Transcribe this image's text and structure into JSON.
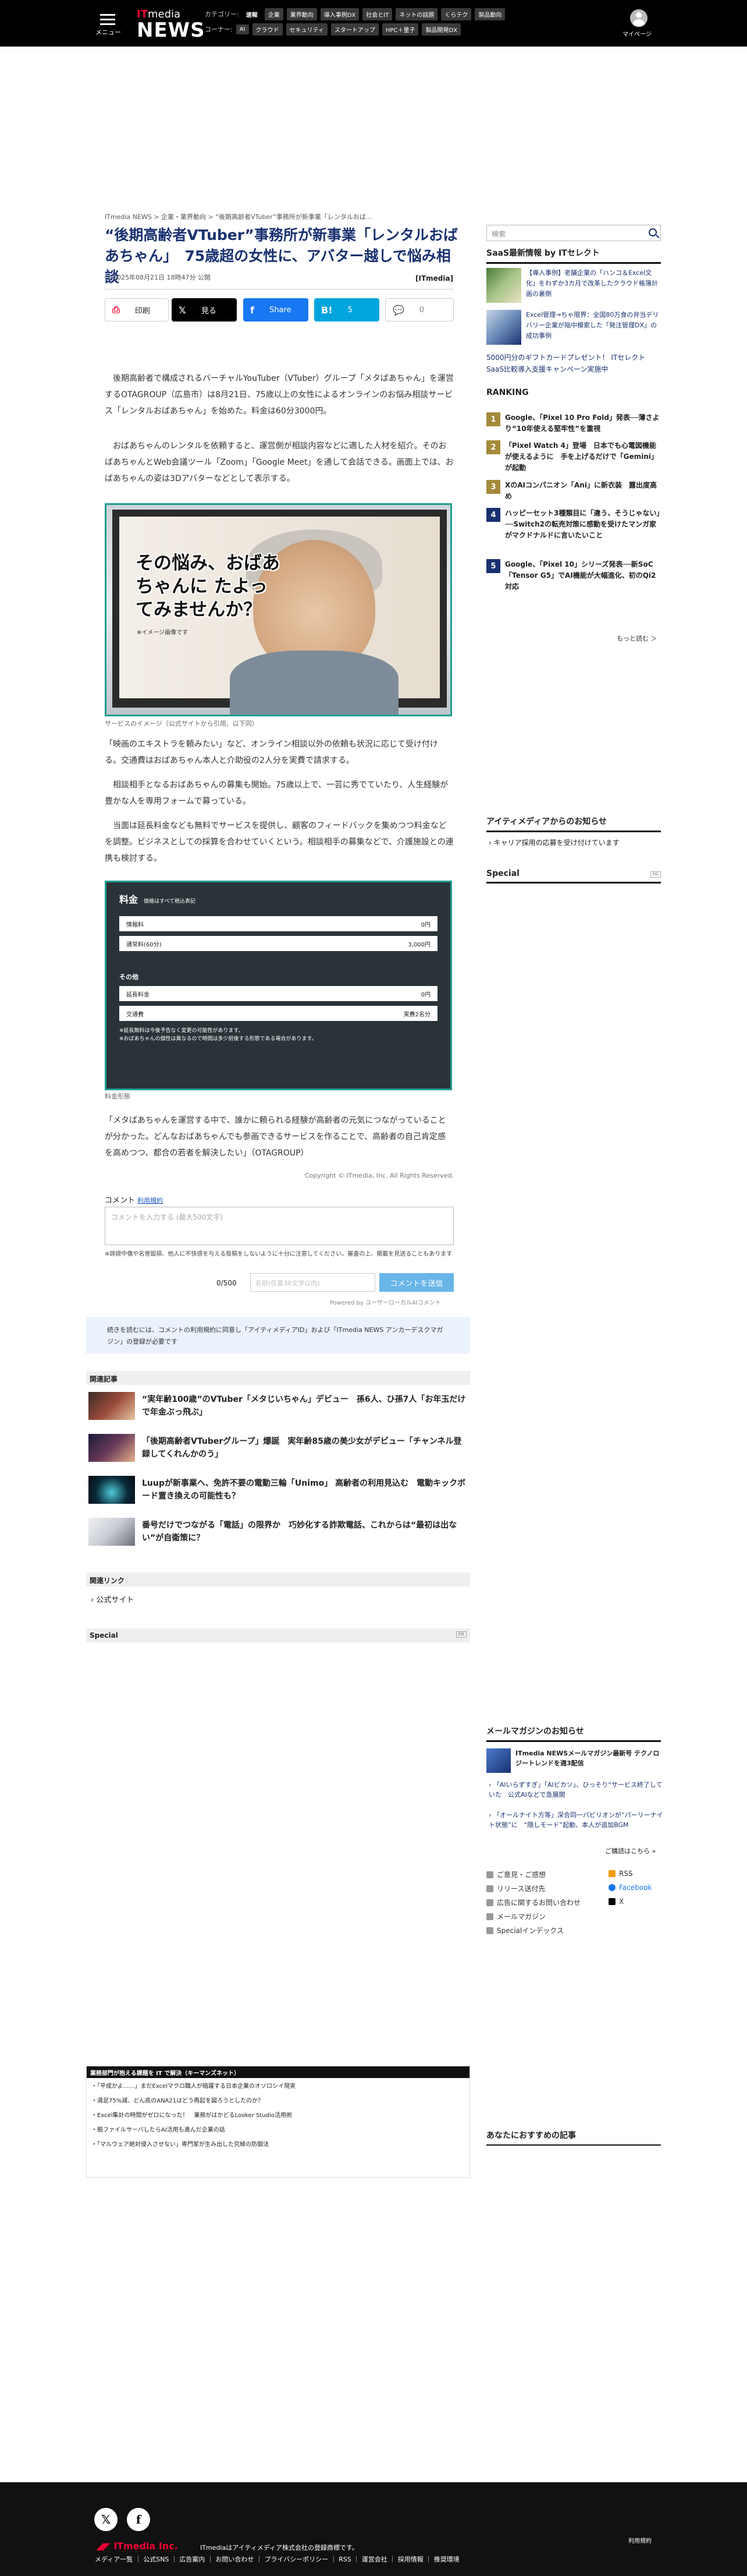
{
  "header": {
    "menu_label": "メニュー",
    "logo_top": "IT",
    "logo_media": "media",
    "logo_news": "NEWS",
    "category_label": "カテゴリー:",
    "categories": [
      "速報",
      "速報",
      "業界動向",
      "導入事例DX",
      "社会とIT",
      "ネットの話題",
      "くらテク",
      "製品",
      "速報"
    ],
    "category_chips": [
      "速報",
      "企業",
      "業界動向",
      "導入事例DX",
      "社会とIT",
      "ネットの話題",
      "くらテク",
      "製品動向"
    ],
    "corner_label": "コーナー:",
    "corner_chips": [
      "AI",
      "クラウド",
      "セキュリティ",
      "スタートアップ",
      "HPC＋量子",
      "製品開発DX"
    ],
    "mypage": "マイページ"
  },
  "article": {
    "breadcrumb": "ITmedia NEWS > 企業・業界動向 > “後期高齢者VTuber”事務所が新事業「レンタルおば…",
    "title": "“後期高齢者VTuber”事務所が新事業「レンタルおばあちゃん」　75歳超の女性に、アバター越しで悩み相談",
    "date": "2025年08月21日 18時47分 公開",
    "publisher": "[ITmedia]",
    "share": {
      "print": "印刷",
      "x": "見る",
      "facebook": "Share",
      "hatena": "5",
      "comments": "0"
    },
    "p1": "　後期高齢者で構成されるバーチャルYouTuber（VTuber）グループ「メタばあちゃん」を運営するOTAGROUP（広島市）は8月21日、75歳以上の女性によるオンラインのお悩み相談サービス「レンタルおばあちゃん」を始めた。料金は60分3000円。",
    "p2": "　おばあちゃんのレンタルを依頼すると、運営側が相談内容などに適した人材を紹介。そのおばあちゃんとWeb会議ツール「Zoom」「Google Meet」を通して会話できる。画面上では、おばあちゃんの姿は3Dアバターなどとして表示する。",
    "hero_headline": "その悩み、おばあちゃんに たよってみませんか？",
    "hero_sub": "※イメージ画像です",
    "hero_caption": "サービスのイメージ（公式サイトから引用、以下同）",
    "p3": "「映画のエキストラを頼みたい」など、オンライン相談以外の依頼も状況に応じて受け付ける。交通費はおばあちゃん本人と介助役の2人分を実費で請求する。",
    "p4": "　相談相手となるおばあちゃんの募集も開始。75歳以上で、一芸に秀でていたり、人生経験が豊かな人を専用フォームで募っている。",
    "p5": "　当面は延長料金なども無料でサービスを提供し、顧客のフィードバックを集めつつ料金などを調整。ビジネスとしての採算を合わせていくという。相談相手の募集などで、介護施設との連携も検討する。",
    "price_title": "料金",
    "price_tax": "価格はすべて税込表記",
    "price_rows": [
      {
        "name": "情報料",
        "value": "0円"
      },
      {
        "name": "通常料(60分)",
        "value": "3,000円"
      }
    ],
    "price_other": "その他",
    "price_rows2": [
      {
        "name": "延長料金",
        "value": "0円"
      },
      {
        "name": "交通費",
        "value": "実費2名分"
      }
    ],
    "price_note": "※延長無料は今後予告なく変更の可能性があります。\n※おばあちゃんの個性は異なるので時間は多少前後する形態である場合があります。",
    "price_caption": "料金形態",
    "p6": "「メタばあちゃんを運営する中で、誰かに頼られる経験が高齢者の元気につながっていることが分かった。どんなおばあちゃんでも参画できるサービスを作ることで、高齢者の自己肯定感を高めつつ、都合の若者を解決したい」（OTAGROUP）",
    "copyright": "Copyright © ITmedia, Inc. All Rights Reserved."
  },
  "comment": {
    "label": "コメント",
    "terms": "利用規約",
    "placeholder": "コメントを入力する (最大500文字)",
    "rule": "※誹謗中傷や名誉毀損、他人に不快感を与える投稿をしないように十分に注意してください。審査の上、掲載を見送ることもあります",
    "count": "0/500",
    "nick_placeholder": "名前(任意30文字以内)",
    "submit": "コメントを送信",
    "powered": "Powered by ユーザーローカルAIコメント",
    "notice": "続きを読むには、コメントの利用規約に同意し「アイティメディアID」および「ITmedia NEWS アンカーデスクマガジン」の登録が必要です"
  },
  "related": {
    "heading": "関連記事",
    "items": [
      "“実年齢100歳”のVTuber「メタじいちゃん」デビュー　孫6人、ひ孫7人「お年玉だけで年金ぶっ飛ぶ」",
      "「後期高齢者VTuberグループ」爆誕　実年齢85歳の美少女がデビュー「チャンネル登録してくれんかのう」",
      "Luupが新事業へ、免許不要の電動三輪「Unimo」 高齢者の利用見込む　電動キックボード置き換えの可能性も？",
      "番号だけでつながる「電話」の限界か　巧妙化する詐欺電話、これからは“最初は出ない”が自衛策に？"
    ],
    "links_heading": "関連リンク",
    "link": "公式サイト",
    "special": "Special",
    "pr": "PR"
  },
  "sidebar": {
    "search_placeholder": "検索",
    "saas_heading": "SaaS最新情報 by ITセレクト",
    "saas_items": [
      "【導入事例】老舗企業の「ハンコ＆Excel文化」をわずか3カ月で改革したクラウド帳簿計画の裏側",
      "Excel管理→ちゃ限界：全国80万食の弁当デリバリー企業が陥中模索した「発注管理DX」の成功事例"
    ],
    "promo": "5000円分のギフトカードプレゼント！ ITセレクトSaaS比較導入支援キャンペーン実施中",
    "ranking_heading": "RANKING",
    "ranking": [
      "Google、「Pixel 10 Pro Fold」発表──薄さより“10年使える堅牢性”を重視",
      "「Pixel Watch 4」登場　日本でも心電図機能が使えるように　手を上げるだけで「Gemini」が起動",
      "XのAIコンパニオン「Ani」に新衣装　露出度高め",
      "ハッピーセット3種類目に「違う、そうじゃない」──Switch2の転売対策に感動を受けたマンガ家がマクドナルドに言いたいこと",
      "Google、「Pixel 10」シリーズ発表──新SoC「Tensor G5」でAI機能が大幅進化、初のQi2対応"
    ],
    "more": "もっと読む ＞",
    "notice_heading": "アイティメディアからのお知らせ",
    "notice_item": "キャリア採用の応募を受け付けています",
    "special": "Special",
    "pr": "PR",
    "mm_heading": "メールマガジンのお知らせ",
    "mm_title": "ITmedia NEWSメールマガジン最新号 テクノロジートレンドを週3配信",
    "mm_items": [
      "「AIいらずすぎ」「AIビカソ」、ひっそり“サービス終了していた　公式AIなどで急展開",
      "「オールナイト方等」深合同一パビリオンが“パーリーナイト状態”に　“隠しモード”起動、本人が追加BGM"
    ],
    "back_numbers": "ご購読はこちら »",
    "foot_links": [
      "ご意見・ご感想",
      "RSS",
      "リリース送付先",
      "Facebook",
      "広告に関するお問い合わせ",
      "X",
      "メールマガジン",
      "Specialインデックス"
    ],
    "recommended": "あなたにおすすめの記事"
  },
  "business": {
    "heading": "業務部門が抱える課題を IT で解決（キーマンズネット）",
    "items": [
      "「平成かよ……」まだExcelマクロ職人が暗躍する日本企業のオソロシイ現実",
      "満足75%減、どん底のANA21はどう再起を図ろうとしたのか？",
      "Excel集計の時間がゼロになった！　業務がはかどるLooker Studio活用術",
      "脱ファイルサーバしたらAI活用も進んだ企業の話",
      "「マルウェア絶対侵入させない」専門家が生み出した究極の防御法"
    ]
  },
  "footer": {
    "top_link": "利用規約",
    "brand": "ITmedia Inc.",
    "registered": "ITmediaはアイティメディア株式会社の登録商標です。",
    "links": "メディア一覧 ｜ 公式SNS ｜ 広告案内 ｜ お問い合わせ ｜ プライバシーポリシー ｜ RSS ｜ 運営会社 ｜ 採用情報 ｜ 推奨環境"
  }
}
